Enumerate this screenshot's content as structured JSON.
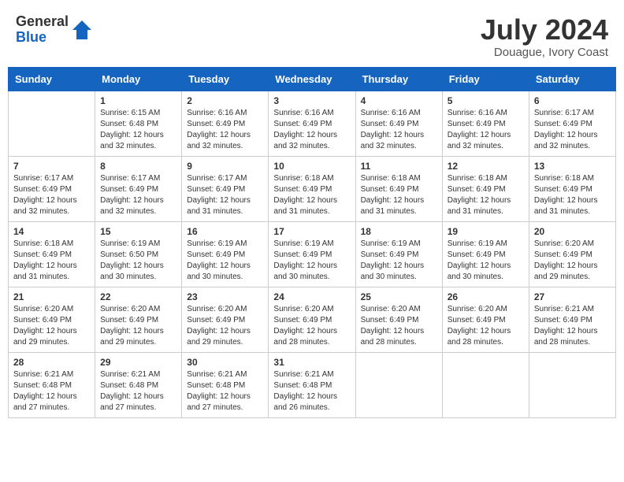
{
  "logo": {
    "general": "General",
    "blue": "Blue"
  },
  "title": {
    "month_year": "July 2024",
    "location": "Douague, Ivory Coast"
  },
  "headers": [
    "Sunday",
    "Monday",
    "Tuesday",
    "Wednesday",
    "Thursday",
    "Friday",
    "Saturday"
  ],
  "weeks": [
    [
      {
        "day": "",
        "sunrise": "",
        "sunset": "",
        "daylight": ""
      },
      {
        "day": "1",
        "sunrise": "Sunrise: 6:15 AM",
        "sunset": "Sunset: 6:48 PM",
        "daylight": "Daylight: 12 hours and 32 minutes."
      },
      {
        "day": "2",
        "sunrise": "Sunrise: 6:16 AM",
        "sunset": "Sunset: 6:49 PM",
        "daylight": "Daylight: 12 hours and 32 minutes."
      },
      {
        "day": "3",
        "sunrise": "Sunrise: 6:16 AM",
        "sunset": "Sunset: 6:49 PM",
        "daylight": "Daylight: 12 hours and 32 minutes."
      },
      {
        "day": "4",
        "sunrise": "Sunrise: 6:16 AM",
        "sunset": "Sunset: 6:49 PM",
        "daylight": "Daylight: 12 hours and 32 minutes."
      },
      {
        "day": "5",
        "sunrise": "Sunrise: 6:16 AM",
        "sunset": "Sunset: 6:49 PM",
        "daylight": "Daylight: 12 hours and 32 minutes."
      },
      {
        "day": "6",
        "sunrise": "Sunrise: 6:17 AM",
        "sunset": "Sunset: 6:49 PM",
        "daylight": "Daylight: 12 hours and 32 minutes."
      }
    ],
    [
      {
        "day": "7",
        "sunrise": "Sunrise: 6:17 AM",
        "sunset": "Sunset: 6:49 PM",
        "daylight": "Daylight: 12 hours and 32 minutes."
      },
      {
        "day": "8",
        "sunrise": "Sunrise: 6:17 AM",
        "sunset": "Sunset: 6:49 PM",
        "daylight": "Daylight: 12 hours and 32 minutes."
      },
      {
        "day": "9",
        "sunrise": "Sunrise: 6:17 AM",
        "sunset": "Sunset: 6:49 PM",
        "daylight": "Daylight: 12 hours and 31 minutes."
      },
      {
        "day": "10",
        "sunrise": "Sunrise: 6:18 AM",
        "sunset": "Sunset: 6:49 PM",
        "daylight": "Daylight: 12 hours and 31 minutes."
      },
      {
        "day": "11",
        "sunrise": "Sunrise: 6:18 AM",
        "sunset": "Sunset: 6:49 PM",
        "daylight": "Daylight: 12 hours and 31 minutes."
      },
      {
        "day": "12",
        "sunrise": "Sunrise: 6:18 AM",
        "sunset": "Sunset: 6:49 PM",
        "daylight": "Daylight: 12 hours and 31 minutes."
      },
      {
        "day": "13",
        "sunrise": "Sunrise: 6:18 AM",
        "sunset": "Sunset: 6:49 PM",
        "daylight": "Daylight: 12 hours and 31 minutes."
      }
    ],
    [
      {
        "day": "14",
        "sunrise": "Sunrise: 6:18 AM",
        "sunset": "Sunset: 6:49 PM",
        "daylight": "Daylight: 12 hours and 31 minutes."
      },
      {
        "day": "15",
        "sunrise": "Sunrise: 6:19 AM",
        "sunset": "Sunset: 6:50 PM",
        "daylight": "Daylight: 12 hours and 30 minutes."
      },
      {
        "day": "16",
        "sunrise": "Sunrise: 6:19 AM",
        "sunset": "Sunset: 6:49 PM",
        "daylight": "Daylight: 12 hours and 30 minutes."
      },
      {
        "day": "17",
        "sunrise": "Sunrise: 6:19 AM",
        "sunset": "Sunset: 6:49 PM",
        "daylight": "Daylight: 12 hours and 30 minutes."
      },
      {
        "day": "18",
        "sunrise": "Sunrise: 6:19 AM",
        "sunset": "Sunset: 6:49 PM",
        "daylight": "Daylight: 12 hours and 30 minutes."
      },
      {
        "day": "19",
        "sunrise": "Sunrise: 6:19 AM",
        "sunset": "Sunset: 6:49 PM",
        "daylight": "Daylight: 12 hours and 30 minutes."
      },
      {
        "day": "20",
        "sunrise": "Sunrise: 6:20 AM",
        "sunset": "Sunset: 6:49 PM",
        "daylight": "Daylight: 12 hours and 29 minutes."
      }
    ],
    [
      {
        "day": "21",
        "sunrise": "Sunrise: 6:20 AM",
        "sunset": "Sunset: 6:49 PM",
        "daylight": "Daylight: 12 hours and 29 minutes."
      },
      {
        "day": "22",
        "sunrise": "Sunrise: 6:20 AM",
        "sunset": "Sunset: 6:49 PM",
        "daylight": "Daylight: 12 hours and 29 minutes."
      },
      {
        "day": "23",
        "sunrise": "Sunrise: 6:20 AM",
        "sunset": "Sunset: 6:49 PM",
        "daylight": "Daylight: 12 hours and 29 minutes."
      },
      {
        "day": "24",
        "sunrise": "Sunrise: 6:20 AM",
        "sunset": "Sunset: 6:49 PM",
        "daylight": "Daylight: 12 hours and 28 minutes."
      },
      {
        "day": "25",
        "sunrise": "Sunrise: 6:20 AM",
        "sunset": "Sunset: 6:49 PM",
        "daylight": "Daylight: 12 hours and 28 minutes."
      },
      {
        "day": "26",
        "sunrise": "Sunrise: 6:20 AM",
        "sunset": "Sunset: 6:49 PM",
        "daylight": "Daylight: 12 hours and 28 minutes."
      },
      {
        "day": "27",
        "sunrise": "Sunrise: 6:21 AM",
        "sunset": "Sunset: 6:49 PM",
        "daylight": "Daylight: 12 hours and 28 minutes."
      }
    ],
    [
      {
        "day": "28",
        "sunrise": "Sunrise: 6:21 AM",
        "sunset": "Sunset: 6:48 PM",
        "daylight": "Daylight: 12 hours and 27 minutes."
      },
      {
        "day": "29",
        "sunrise": "Sunrise: 6:21 AM",
        "sunset": "Sunset: 6:48 PM",
        "daylight": "Daylight: 12 hours and 27 minutes."
      },
      {
        "day": "30",
        "sunrise": "Sunrise: 6:21 AM",
        "sunset": "Sunset: 6:48 PM",
        "daylight": "Daylight: 12 hours and 27 minutes."
      },
      {
        "day": "31",
        "sunrise": "Sunrise: 6:21 AM",
        "sunset": "Sunset: 6:48 PM",
        "daylight": "Daylight: 12 hours and 26 minutes."
      },
      {
        "day": "",
        "sunrise": "",
        "sunset": "",
        "daylight": ""
      },
      {
        "day": "",
        "sunrise": "",
        "sunset": "",
        "daylight": ""
      },
      {
        "day": "",
        "sunrise": "",
        "sunset": "",
        "daylight": ""
      }
    ]
  ]
}
